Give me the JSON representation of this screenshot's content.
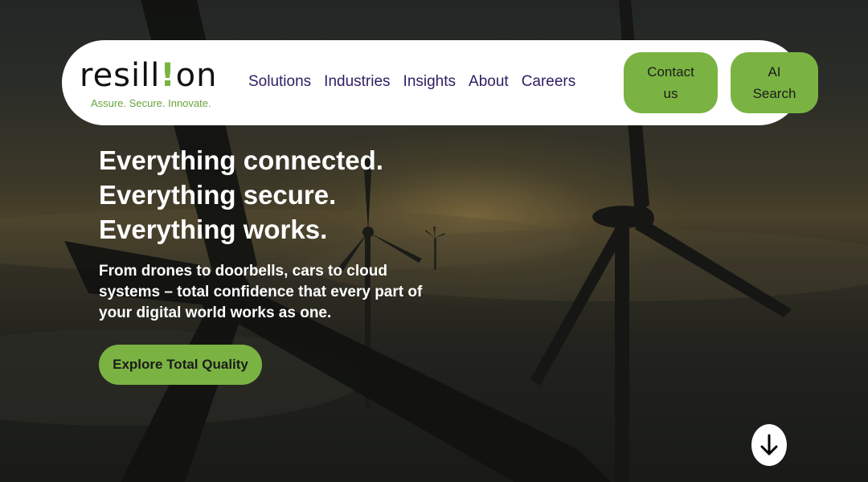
{
  "header": {
    "logo": {
      "wordmark": "resill!on",
      "tagline": "Assure. Secure. Innovate."
    },
    "nav": [
      {
        "label": "Solutions"
      },
      {
        "label": "Industries"
      },
      {
        "label": "Insights"
      },
      {
        "label": "About"
      },
      {
        "label": "Careers"
      }
    ],
    "contact_label": "Contact us",
    "ai_search_label": "AI Search"
  },
  "hero": {
    "headline": [
      "Everything connected.",
      "Everything secure.",
      "Everything works."
    ],
    "subtext": "From drones to doorbells, cars to cloud systems – total confidence that every part of your digital world works as one.",
    "cta_label": "Explore Total Quality",
    "scroll_icon": "arrow-down-icon"
  },
  "colors": {
    "brand_green": "#7ab342",
    "nav_text": "#2f1e63",
    "tagline_green": "#6aa33d",
    "logo_accent": "#7ab342"
  }
}
